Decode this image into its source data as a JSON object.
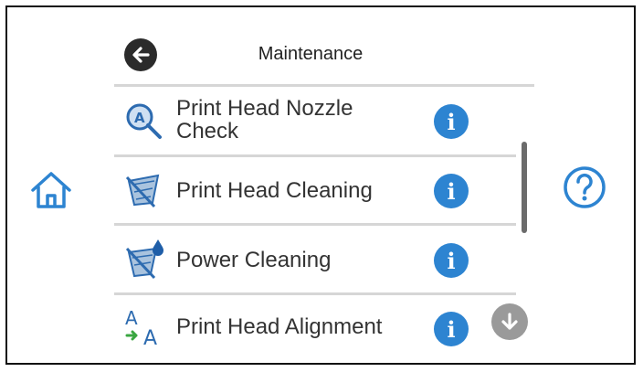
{
  "header": {
    "title": "Maintenance",
    "back_icon": "back-arrow-icon"
  },
  "menu": {
    "items": [
      {
        "label_line1": "Print Head Nozzle",
        "label_line2": "Check",
        "icon": "nozzle-check-icon"
      },
      {
        "label": "Print Head Cleaning",
        "icon": "head-cleaning-icon"
      },
      {
        "label": "Power Cleaning",
        "icon": "power-cleaning-icon"
      },
      {
        "label": "Print Head Alignment",
        "icon": "head-alignment-icon"
      }
    ],
    "info_icon": "info-icon"
  },
  "side": {
    "home_icon": "home-icon",
    "help_icon": "help-icon"
  },
  "scroll": {
    "down_icon": "scroll-down-icon"
  },
  "colors": {
    "accent_blue": "#2d84d1",
    "dark_icon": "#2b2b2b",
    "divider": "#d6d6d6",
    "scroll_thumb": "#6b6b6b",
    "scroll_button": "#9a9a9a"
  }
}
